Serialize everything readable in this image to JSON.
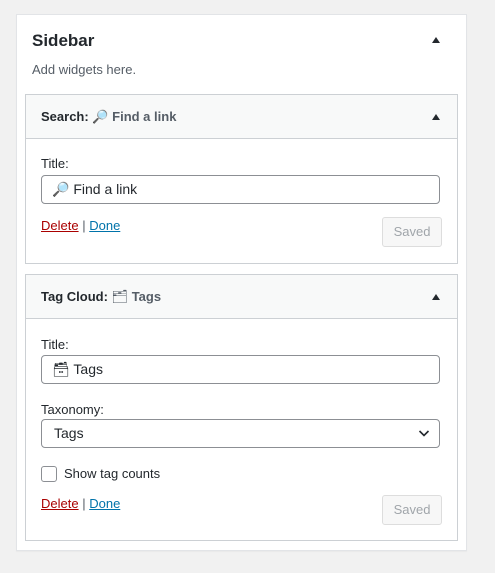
{
  "sidebar": {
    "title": "Sidebar",
    "description": "Add widgets here."
  },
  "widgets": {
    "search": {
      "header_type": "Search:",
      "header_name": "Find a link",
      "header_icon": "magnifier-emoji",
      "title_label": "Title:",
      "title_value": "Find a link",
      "title_icon": "magnifier-emoji",
      "delete_label": "Delete",
      "separator": "|",
      "done_label": "Done",
      "saved_label": "Saved"
    },
    "tag_cloud": {
      "header_type": "Tag Cloud:",
      "header_name": "Tags",
      "header_icon": "folder-emoji",
      "title_label": "Title:",
      "title_value": "Tags",
      "title_icon": "card-box-emoji",
      "taxonomy_label": "Taxonomy:",
      "taxonomy_value": "Tags",
      "checkbox_label": "Show tag counts",
      "checkbox_checked": false,
      "delete_label": "Delete",
      "separator": "|",
      "done_label": "Done",
      "saved_label": "Saved"
    }
  },
  "colors": {
    "delete": "#aa0000",
    "done": "#0073aa"
  }
}
